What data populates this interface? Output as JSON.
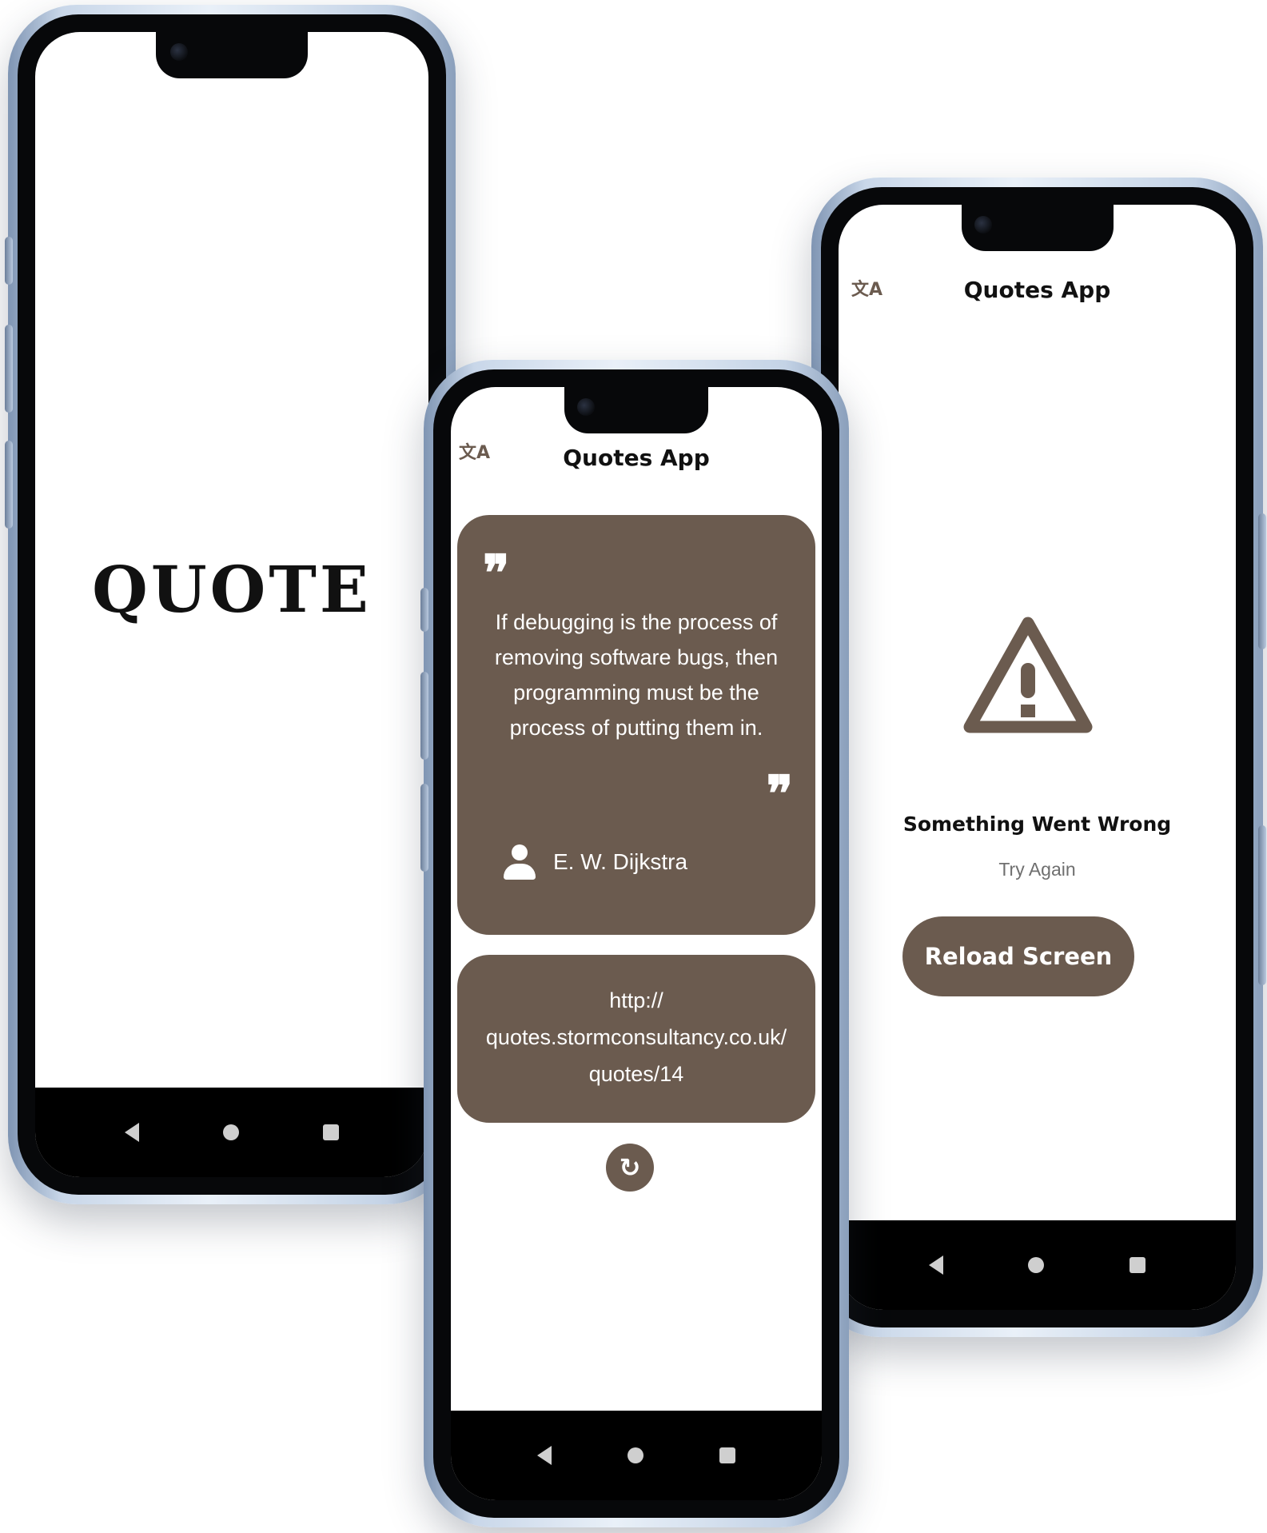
{
  "brand": {
    "accent": "#6b5b4f",
    "frame": "#c9d7e9"
  },
  "splash": {
    "logo_text": "QUOTE"
  },
  "quote_screen": {
    "app_title": "Quotes App",
    "translate_icon": "translate-icon",
    "open_quote_glyph": "❞",
    "close_quote_glyph": "❞",
    "quote_text": "If debugging is the process of removing software bugs, then programming must be the process of putting them in.",
    "author": "E. W. Dijkstra",
    "author_icon": "person-icon",
    "link_line1": "http://",
    "link_line2": "quotes.stormconsultancy.co.uk/",
    "link_line3": "quotes/14",
    "refresh_icon": "refresh-icon",
    "refresh_glyph": "↻"
  },
  "error_screen": {
    "app_title": "Quotes App",
    "translate_icon": "translate-icon",
    "warning_icon": "warning-icon",
    "title": "Something Went Wrong",
    "subtitle": "Try Again",
    "reload_label": "Reload Screen"
  },
  "nav_bar": {
    "back_icon": "back-icon",
    "home_icon": "home-icon",
    "recents_icon": "recents-icon"
  }
}
